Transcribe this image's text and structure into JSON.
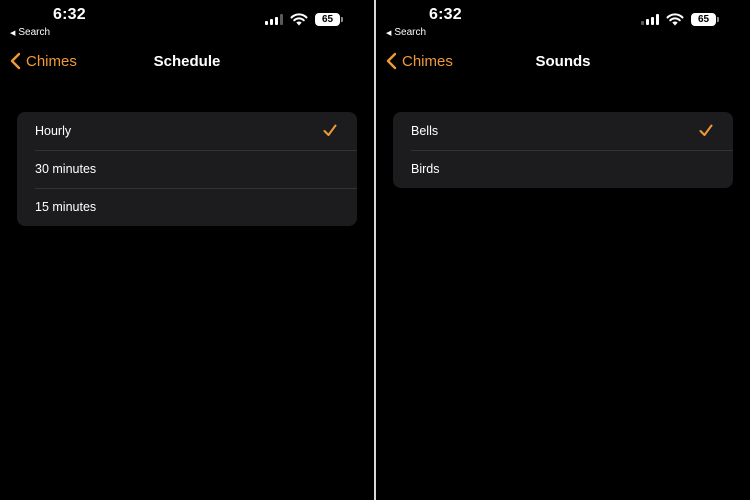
{
  "accent_color": "#f09a37",
  "screens": [
    {
      "status": {
        "time": "6:32",
        "back_label": "Search",
        "battery": "65"
      },
      "nav": {
        "back_label": "Chimes",
        "title": "Schedule"
      },
      "items": [
        {
          "label": "Hourly",
          "selected": true
        },
        {
          "label": "30 minutes",
          "selected": false
        },
        {
          "label": "15 minutes",
          "selected": false
        }
      ]
    },
    {
      "status": {
        "time": "6:32",
        "back_label": "Search",
        "battery": "65"
      },
      "nav": {
        "back_label": "Chimes",
        "title": "Sounds"
      },
      "items": [
        {
          "label": "Bells",
          "selected": true
        },
        {
          "label": "Birds",
          "selected": false
        }
      ]
    }
  ],
  "icons": {
    "status_back": "triangle-left-icon",
    "signal": "cellular-signal-icon",
    "wifi": "wifi-icon",
    "battery": "battery-icon",
    "nav_back": "chevron-left-icon",
    "selected": "checkmark-icon"
  }
}
